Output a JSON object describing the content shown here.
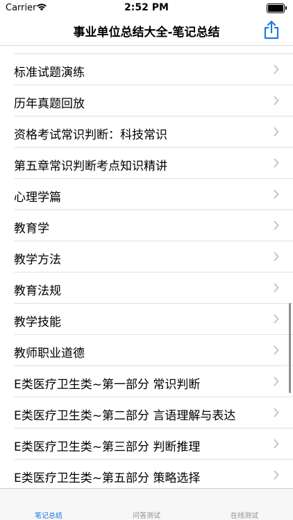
{
  "status_bar": {
    "carrier": "Carrier",
    "time": "2:52 PM"
  },
  "nav": {
    "title": "事业单位总结大全-笔记总结"
  },
  "list": {
    "items": [
      {
        "label": "标准试题演练"
      },
      {
        "label": "历年真题回放"
      },
      {
        "label": "资格考试常识判断：科技常识"
      },
      {
        "label": "第五章常识判断考点知识精讲"
      },
      {
        "label": "心理学篇"
      },
      {
        "label": "教育学"
      },
      {
        "label": "教学方法"
      },
      {
        "label": "教育法规"
      },
      {
        "label": "教学技能"
      },
      {
        "label": "教师职业道德"
      },
      {
        "label": "E类医疗卫生类~第一部分 常识判断"
      },
      {
        "label": "E类医疗卫生类~第二部分 言语理解与表达"
      },
      {
        "label": "E类医疗卫生类~第三部分 判断推理"
      },
      {
        "label": "E类医疗卫生类~第五部分 策略选择"
      }
    ]
  },
  "tabs": [
    {
      "label": "笔记总结",
      "active": true
    },
    {
      "label": "问答测试",
      "active": false
    },
    {
      "label": "在线测试",
      "active": false
    }
  ],
  "colors": {
    "accent": "#1f7ae0",
    "inactive_tab": "#8e8e93",
    "separator": "#e0e0e0",
    "chevron": "#c4c4c7"
  },
  "icons": {
    "share": "share-icon",
    "chevron": "chevron-right-icon",
    "wifi": "wifi-icon",
    "battery": "battery-icon"
  }
}
